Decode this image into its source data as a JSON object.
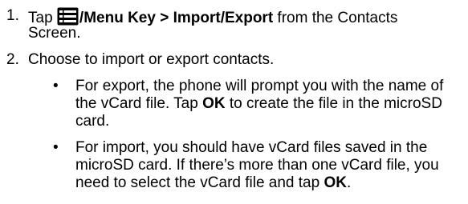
{
  "steps": [
    {
      "number": "1.",
      "icon": "menu-key-icon",
      "lead_bold": "/Menu Key > Import/Export",
      "lead_rest": " from the Contacts",
      "pre_icon": "Tap ",
      "line2": "Screen."
    },
    {
      "number": "2.",
      "text": "Choose to import or export contacts."
    }
  ],
  "bullets": [
    {
      "dot": "•",
      "line1": "For export, the phone will prompt you with the name of",
      "line2_pre": "the vCard file. Tap ",
      "line2_bold": "OK",
      "line2_post": " to create the file in the microSD",
      "line3": "card."
    },
    {
      "dot": "•",
      "line1": "For import, you should have vCard files saved in the",
      "line2": "microSD card. If there’s more than one vCard file, you",
      "line3_pre": "need to select the vCard file and tap ",
      "line3_bold": "OK",
      "line3_post": "."
    }
  ]
}
